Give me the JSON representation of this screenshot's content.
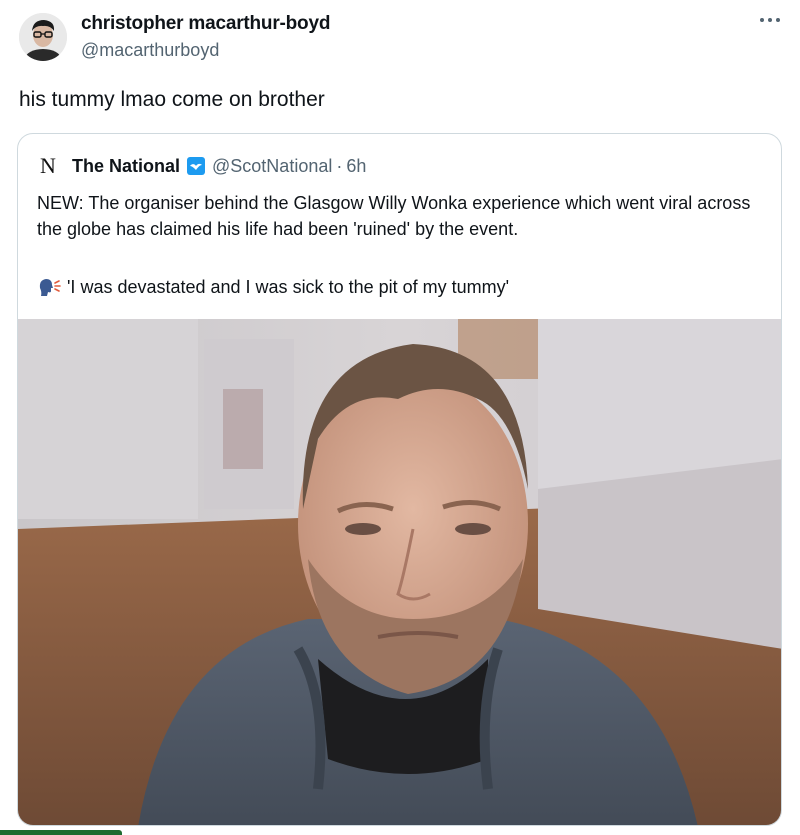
{
  "author": {
    "name": "christopher macarthur-boyd",
    "handle": "@macarthurboyd"
  },
  "tweet": {
    "text": "his tummy lmao come on brother"
  },
  "menu": {
    "icon": "more-horizontal-icon"
  },
  "quote": {
    "logo_letter": "N",
    "name": "The National",
    "verified_icon": "verified-badge-icon",
    "handle": "@ScotNational",
    "separator": "·",
    "time": "6h",
    "body": "NEW: The organiser behind the Glasgow Willy Wonka experience which went viral across the globe has claimed his life had been 'ruined' by the event.",
    "quote_line": "'I was devastated and I was sick to the pit of my tummy'",
    "quote_icon": "speaking-head-icon"
  },
  "colors": {
    "text": "#0f1419",
    "secondary": "#536471",
    "border": "#cfd9de",
    "verified": "#1d9bf0"
  }
}
